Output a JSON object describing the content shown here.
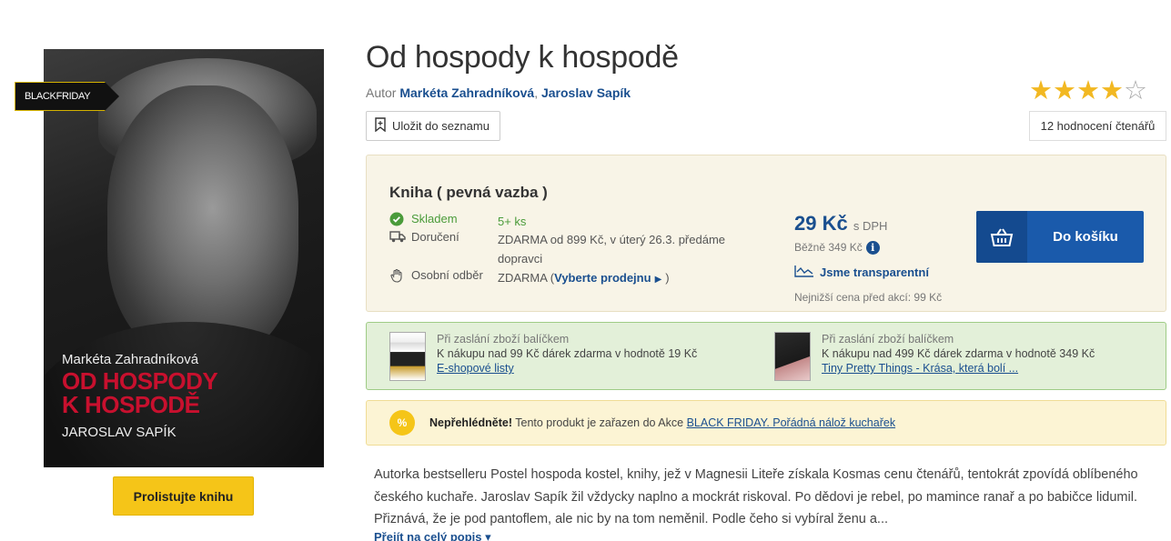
{
  "cover": {
    "author_top": "Markéta Zahradníková",
    "title_line1": "OD HOSPODY",
    "title_line2": "K HOSPODĚ",
    "author_bottom": "JAROSLAV SAPÍK",
    "badge": "BLACKFRIDAY"
  },
  "browse_button": "Prolistujte knihu",
  "product": {
    "title": "Od hospody k hospodě",
    "author_prefix": "Autor",
    "author1": "Markéta Zahradníková",
    "separator": ",",
    "author2": "Jaroslav Sapík",
    "save_label": "Uložit do seznamu"
  },
  "rating": {
    "stars_filled": 4,
    "stars_total": 5,
    "count_label": "12 hodnocení čtenářů"
  },
  "buy": {
    "format": "Kniha ( pevná vazba )",
    "stock_label": "Skladem",
    "stock_value": "5+ ks",
    "delivery_label": "Doručení",
    "delivery_value": "ZDARMA od 899 Kč, v úterý 26.3. předáme dopravci",
    "pickup_label": "Osobní odběr",
    "pickup_value_prefix": "ZDARMA (",
    "pickup_link": "Vyberte prodejnu",
    "pickup_value_suffix": ")",
    "price": "29 Kč",
    "price_suffix": "s DPH",
    "regular_price": "Běžně 349 Kč",
    "transparent_label": "Jsme transparentní",
    "lowest_price": "Nejnižší cena před akcí: 99 Kč",
    "cart_label": "Do košíku"
  },
  "gifts": [
    {
      "heading": "Při zaslání zboží balíčkem",
      "text": "K nákupu nad 99 Kč dárek zdarma v hodnotě 19 Kč",
      "link": "E-shopové listy"
    },
    {
      "heading": "Při zaslání zboží balíčkem",
      "text": "K nákupu nad 499 Kč dárek zdarma v hodnotě 349 Kč",
      "link": "Tiny Pretty Things - Krása, která bolí ..."
    }
  ],
  "alert": {
    "icon_text": "%",
    "bold": "Nepřehlédněte!",
    "text": " Tento produkt je zařazen do Akce ",
    "link": "BLACK FRIDAY. Pořádná nálož kuchařek"
  },
  "description": {
    "text": "Autorka bestselleru Postel hospoda kostel, knihy, jež v Magnesii Liteře získala Kosmas cenu čtenářů, tentokrát zpovídá oblíbeného českého kuchaře. Jaroslav Sapík žil vždycky naplno a mockrát riskoval. Po dědovi je rebel, po mamince ranař a po babičce lidumil. Přiznává, že je pod pantoflem, ale nic by na tom neměnil. Podle čeho si vybíral ženu a...",
    "more": "Přejít na celý popis"
  }
}
